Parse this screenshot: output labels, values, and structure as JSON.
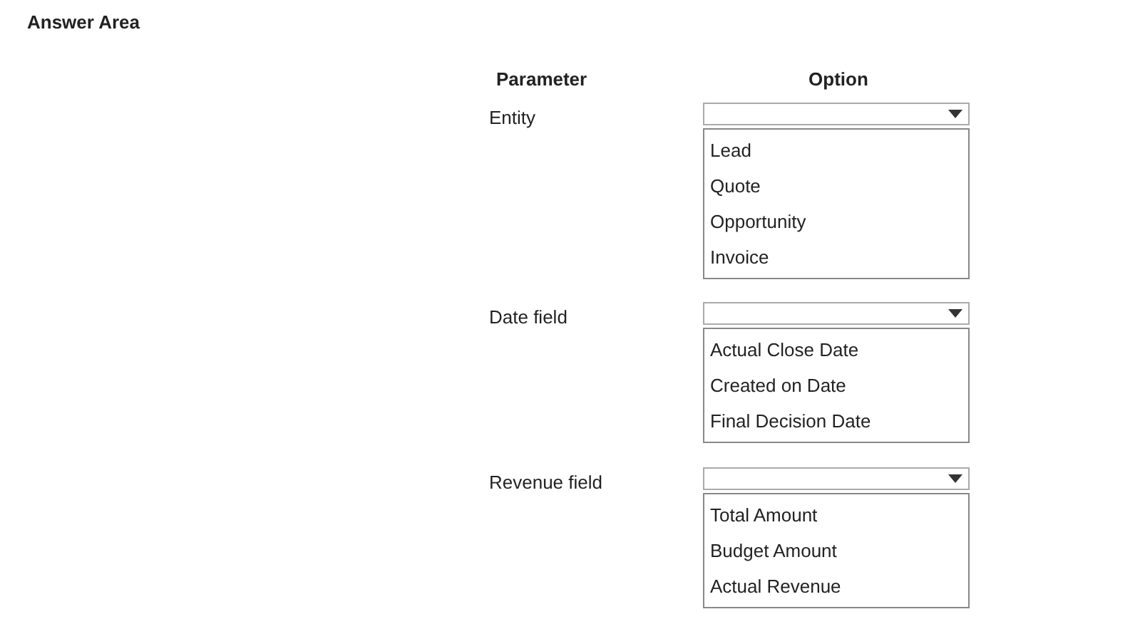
{
  "title": "Answer Area",
  "columns": [
    "Parameter",
    "Option"
  ],
  "parameters": [
    {
      "label": "Entity",
      "options": [
        "Lead",
        "Quote",
        "Opportunity",
        "Invoice"
      ]
    },
    {
      "label": "Date field",
      "options": [
        "Actual Close Date",
        "Created on Date",
        "Final Decision Date"
      ]
    },
    {
      "label": "Revenue field",
      "options": [
        "Total Amount",
        "Budget Amount",
        "Actual Revenue"
      ]
    }
  ]
}
